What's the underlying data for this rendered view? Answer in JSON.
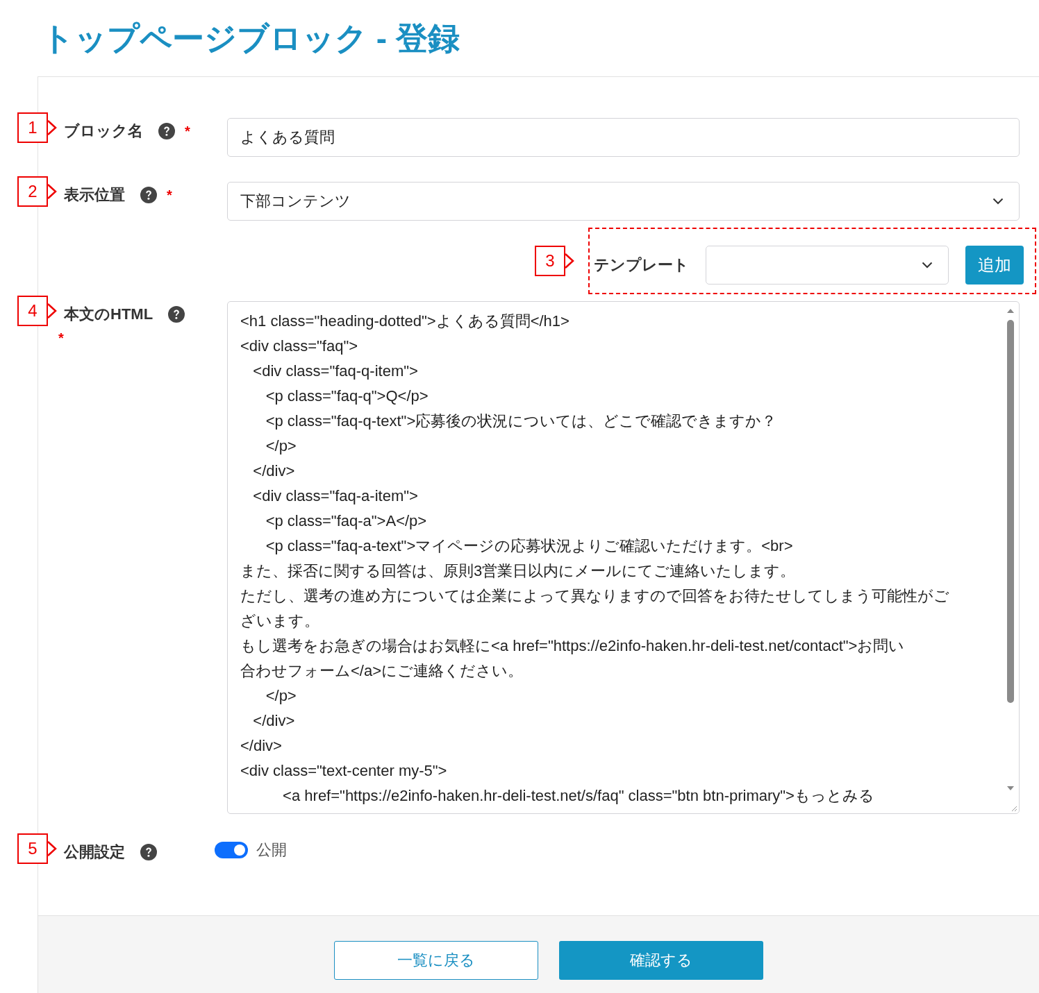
{
  "page_title": "トップページブロック - 登録",
  "fields": [
    {
      "kind": "text",
      "callout": "1",
      "label": "ブロック名",
      "required_mark": "*",
      "value": "よくある質問"
    },
    {
      "kind": "select",
      "callout": "2",
      "label": "表示位置",
      "required_mark": "*",
      "value": "下部コンテンツ"
    }
  ],
  "template_picker": {
    "callout": "3",
    "label": "テンプレート",
    "button": "追加"
  },
  "html_body": {
    "callout": "4",
    "label": "本文のHTML",
    "required_mark": "*",
    "lines": [
      "<h1 class=\"heading-dotted\">よくある質問</h1>",
      "<div class=\"faq\">",
      "   <div class=\"faq-q-item\">",
      "      <p class=\"faq-q\">Q</p>",
      "      <p class=\"faq-q-text\">応募後の状況については、どこで確認できますか？",
      "      </p>",
      "   </div>",
      "   <div class=\"faq-a-item\">",
      "      <p class=\"faq-a\">A</p>",
      "      <p class=\"faq-a-text\">マイページの応募状況よりご確認いただけます。<br>",
      "また、採否に関する回答は、原則3営業日以内にメールにてご連絡いたします。",
      "ただし、選考の進め方については企業によって異なりますので回答をお待たせしてしまう可能性がご",
      "ざいます。",
      "もし選考をお急ぎの場合はお気軽に<a href=\"https://e2info-haken.hr-deli-test.net/contact\">お問い",
      "合わせフォーム</a>にご連絡ください。",
      "      </p>",
      "   </div>",
      "</div>",
      "<div class=\"text-center my-5\">",
      "          <a href=\"https://e2info-haken.hr-deli-test.net/s/faq\" class=\"btn btn-primary\">もっとみる"
    ]
  },
  "publish": {
    "callout": "5",
    "label": "公開設定",
    "on": true,
    "toggle_label": "公開"
  },
  "footer_buttons": [
    {
      "kind": "secondary",
      "label": "一覧に戻る"
    },
    {
      "kind": "primary",
      "label": "確認する"
    }
  ]
}
